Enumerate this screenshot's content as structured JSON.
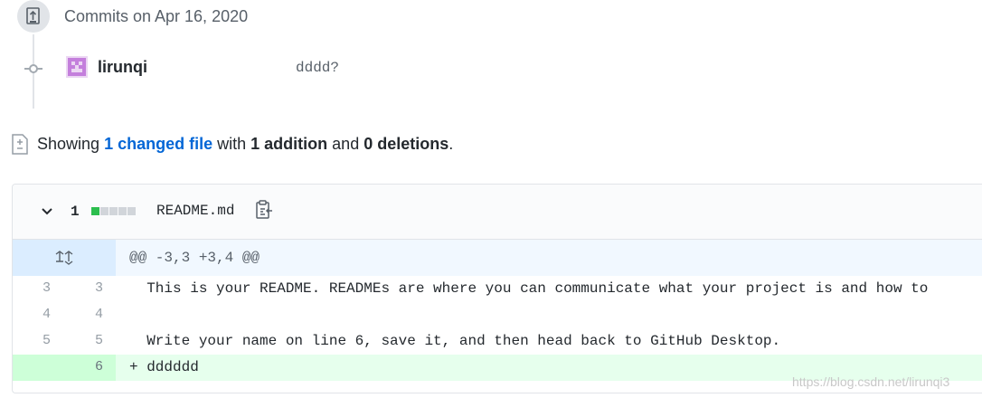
{
  "timeline": {
    "date_label": "Commits on Apr 16, 2020"
  },
  "commit": {
    "author": "lirunqi",
    "message": "dddd?"
  },
  "summary": {
    "showing": "Showing",
    "changed_files_link": "1 changed file",
    "with": "with",
    "additions": "1 addition",
    "and": "and",
    "deletions": "0 deletions",
    "period": "."
  },
  "file": {
    "changes": "1",
    "name": "README.md",
    "diffstat": [
      "add",
      "neutral",
      "neutral",
      "neutral",
      "neutral"
    ]
  },
  "diff": {
    "hunk_header": "@@ -3,3 +3,4 @@",
    "lines": [
      {
        "type": "context",
        "old": "3",
        "new": "3",
        "text": "  This is your README. READMEs are where you can communicate what your project is and how to"
      },
      {
        "type": "context",
        "old": "4",
        "new": "4",
        "text": ""
      },
      {
        "type": "context",
        "old": "5",
        "new": "5",
        "text": "  Write your name on line 6, save it, and then head back to GitHub Desktop."
      },
      {
        "type": "add",
        "old": "",
        "new": "6",
        "text": "+ dddddd"
      }
    ]
  },
  "watermark": "https://blog.csdn.net/lirunqi3",
  "colors": {
    "link": "#0366d6",
    "add_bg": "#e6ffed",
    "add_gutter": "#cdffd8",
    "hunk_bg": "#f1f8ff",
    "hunk_gutter": "#dbedff",
    "diffstat_add": "#2cbe4e",
    "diffstat_neutral": "#d1d5da"
  }
}
